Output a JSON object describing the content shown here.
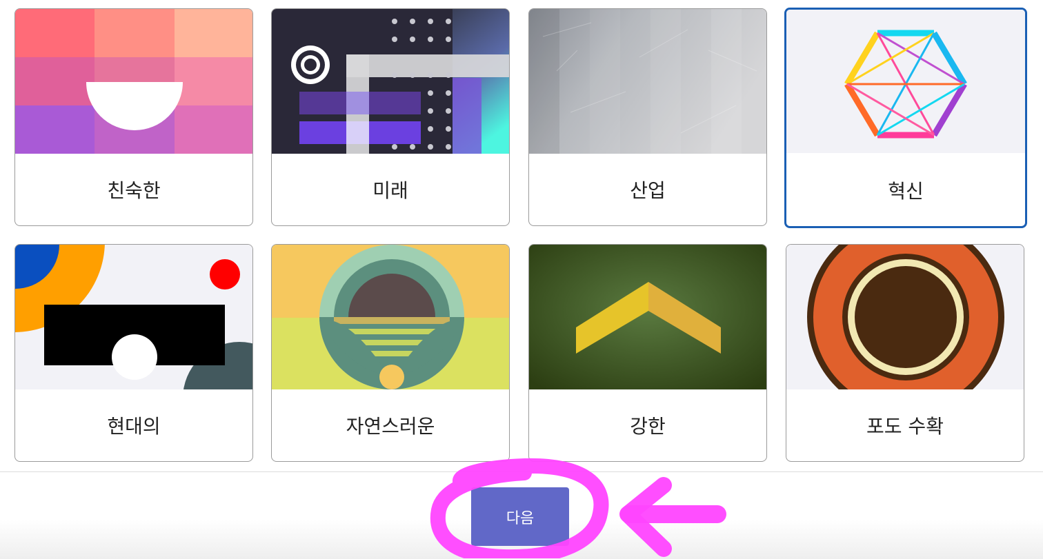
{
  "themes": [
    {
      "label": "친숙한",
      "selected": false
    },
    {
      "label": "미래",
      "selected": false
    },
    {
      "label": "산업",
      "selected": false
    },
    {
      "label": "혁신",
      "selected": true
    },
    {
      "label": "현대의",
      "selected": false
    },
    {
      "label": "자연스러운",
      "selected": false
    },
    {
      "label": "강한",
      "selected": false
    },
    {
      "label": "포도 수확",
      "selected": false
    }
  ],
  "footer": {
    "next_label": "다음"
  },
  "colors": {
    "accent": "#6168c8",
    "selected_border": "#1a5fb4",
    "annotation": "#ff44ff"
  }
}
